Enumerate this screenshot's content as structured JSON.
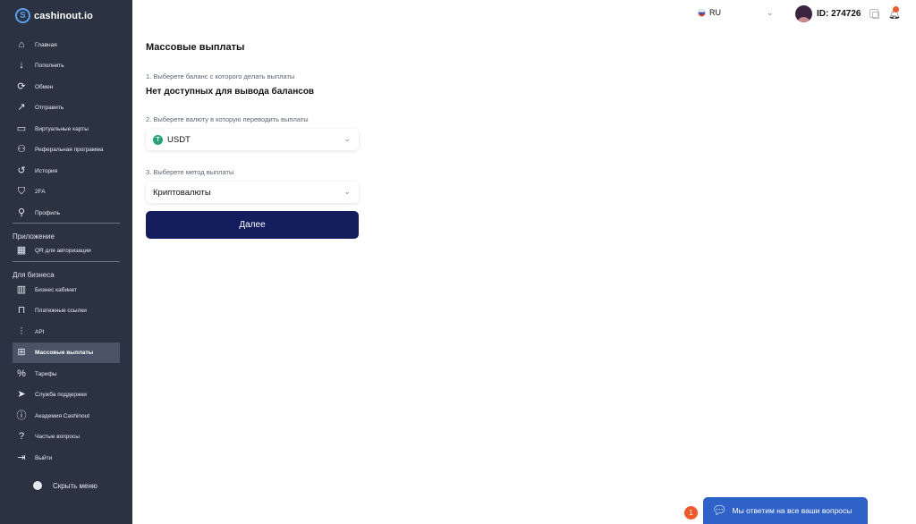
{
  "brand": {
    "name": "cashinout.io"
  },
  "sidebar": {
    "items": [
      {
        "label": "Главная",
        "icon": "home-icon",
        "glyph": "⌂"
      },
      {
        "label": "Пополнить",
        "icon": "download-icon",
        "glyph": "↓"
      },
      {
        "label": "Обмен",
        "icon": "exchange-icon",
        "glyph": "⟳"
      },
      {
        "label": "Отправить",
        "icon": "send-arrow-icon",
        "glyph": "↗"
      },
      {
        "label": "Виртуальные карты",
        "icon": "card-icon",
        "glyph": "▭"
      },
      {
        "label": "Реферальная программа",
        "icon": "users-icon",
        "glyph": "⚇"
      },
      {
        "label": "История",
        "icon": "history-icon",
        "glyph": "↺"
      },
      {
        "label": "2FA",
        "icon": "shield-icon",
        "glyph": "⛉"
      },
      {
        "label": "Профиль",
        "icon": "user-icon",
        "glyph": "⚲"
      }
    ],
    "app_section": "Приложение",
    "app_items": [
      {
        "label": "QR для авторизации",
        "icon": "qr-icon",
        "glyph": "▦"
      }
    ],
    "business_section": "Для бизнеса",
    "business_items": [
      {
        "label": "Бизнес кабинет",
        "icon": "building-icon",
        "glyph": "▥"
      },
      {
        "label": "Платежные ссылки",
        "icon": "bag-icon",
        "glyph": "⊓"
      },
      {
        "label": "API",
        "icon": "sliders-icon",
        "glyph": "⫶"
      },
      {
        "label": "Массовые выплаты",
        "icon": "grid-icon",
        "glyph": "⊞",
        "active": true
      },
      {
        "label": "Тарифы",
        "icon": "percent-icon",
        "glyph": "%"
      },
      {
        "label": "Служба поддержки",
        "icon": "paper-plane-icon",
        "glyph": "➤"
      },
      {
        "label": "Академия Cashinout",
        "icon": "info-icon",
        "glyph": "ⓘ"
      },
      {
        "label": "Частые вопросы",
        "icon": "question-icon",
        "glyph": "?"
      },
      {
        "label": "Выйти",
        "icon": "logout-icon",
        "glyph": "⇥"
      }
    ],
    "hide_menu": "Скрыть меню"
  },
  "header": {
    "language": "RU",
    "user_id": "ID: 274726"
  },
  "main": {
    "title": "Массовые выплаты",
    "step1_label": "1. Выберете баланс с которого делать выплаты",
    "no_balance": "Нет доступных для вывода балансов",
    "step2_label": "2. Выберете валюту в которую переводить выплаты",
    "currency_value": "USDT",
    "step3_label": "3. Выберете метод выплаты",
    "method_value": "Криптовалюты",
    "next_button": "Далее"
  },
  "chat": {
    "badge_count": "1",
    "label": "Мы ответим на все ваши вопросы"
  },
  "colors": {
    "sidebar_bg": "#2b3342",
    "primary_button": "#141d5e",
    "chat_button": "#2f62c8",
    "badge": "#f05a28"
  }
}
